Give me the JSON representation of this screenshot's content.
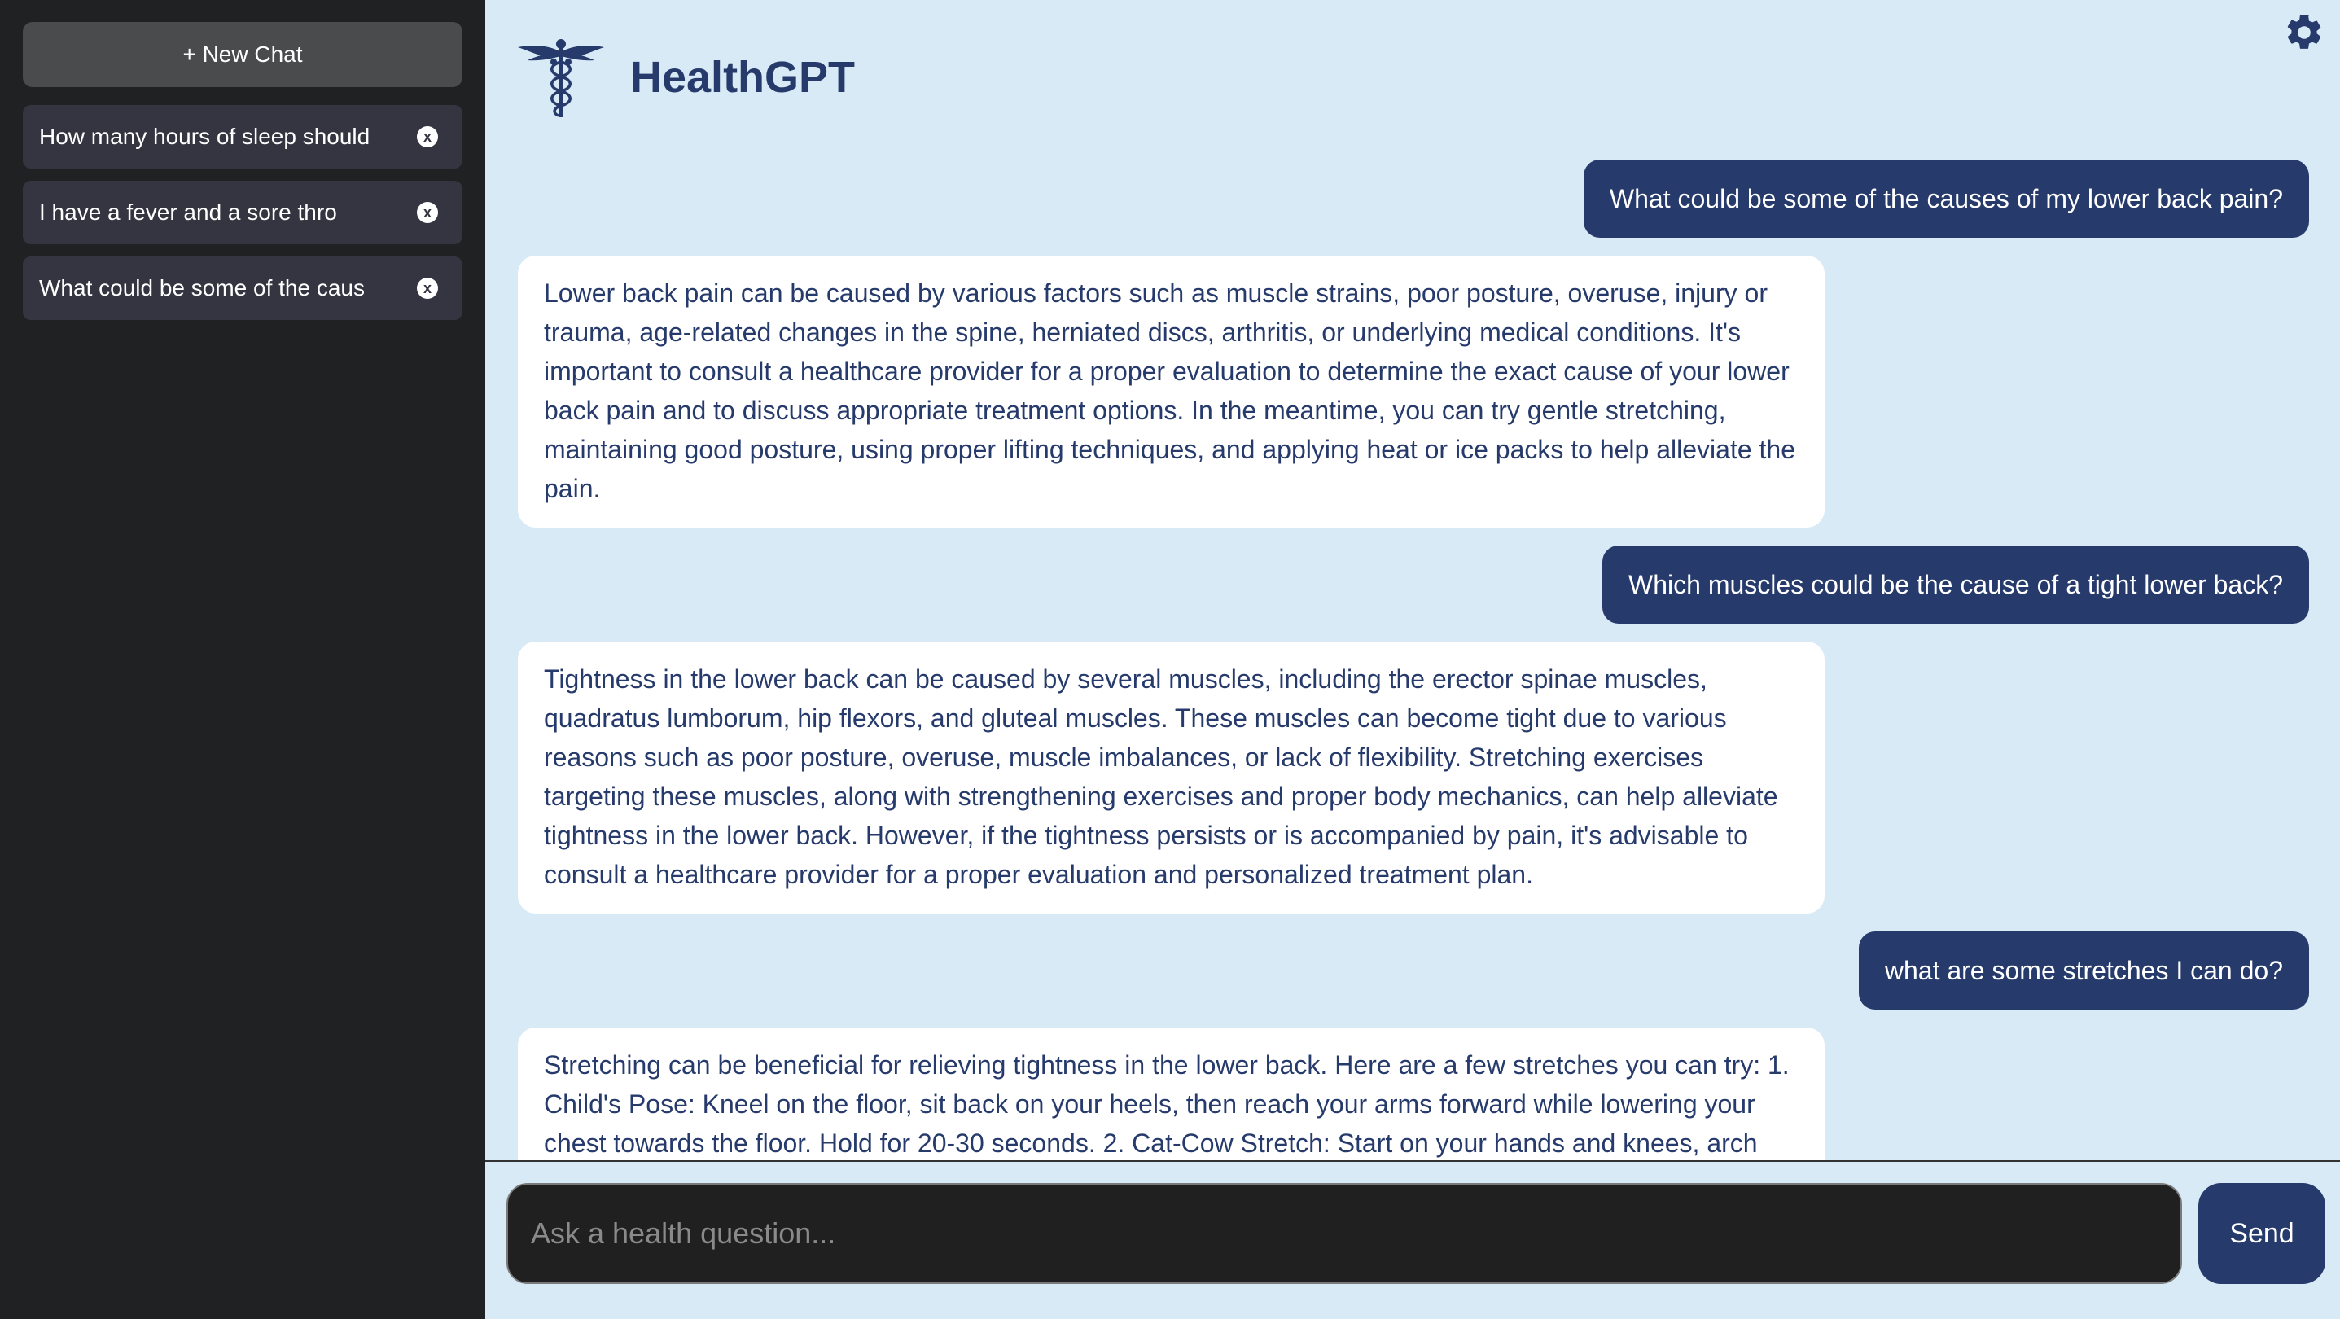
{
  "sidebar": {
    "new_chat_label": "+ New Chat",
    "history": [
      {
        "label": "How many hours of sleep should"
      },
      {
        "label": "I have a fever and a sore thro"
      },
      {
        "label": "What could be some of the caus"
      }
    ],
    "close_glyph": "x"
  },
  "header": {
    "title": "HealthGPT",
    "logo_icon": "caduceus-icon",
    "settings_icon": "gear-icon"
  },
  "messages": [
    {
      "role": "user",
      "text": "What could be some of the causes of my lower back pain?"
    },
    {
      "role": "assistant",
      "text": "Lower back pain can be caused by various factors such as muscle strains, poor posture, overuse, injury or trauma, age-related changes in the spine, herniated discs, arthritis, or underlying medical conditions. It's important to consult a healthcare provider for a proper evaluation to determine the exact cause of your lower back pain and to discuss appropriate treatment options. In the meantime, you can try gentle stretching, maintaining good posture, using proper lifting techniques, and applying heat or ice packs to help alleviate the pain."
    },
    {
      "role": "user",
      "text": "Which muscles could be the cause of a tight lower back?"
    },
    {
      "role": "assistant",
      "text": "Tightness in the lower back can be caused by several muscles, including the erector spinae muscles, quadratus lumborum, hip flexors, and gluteal muscles. These muscles can become tight due to various reasons such as poor posture, overuse, muscle imbalances, or lack of flexibility. Stretching exercises targeting these muscles, along with strengthening exercises and proper body mechanics, can help alleviate tightness in the lower back. However, if the tightness persists or is accompanied by pain, it's advisable to consult a healthcare provider for a proper evaluation and personalized treatment plan."
    },
    {
      "role": "user",
      "text": "what are some stretches I can do?"
    },
    {
      "role": "assistant",
      "text": "Stretching can be beneficial for relieving tightness in the lower back. Here are a few stretches you can try: 1. Child's Pose: Kneel on the floor, sit back on your heels, then reach your arms forward while lowering your chest towards the floor. Hold for 20-30 seconds. 2. Cat-Cow Stretch: Start on your hands and knees, arch"
    }
  ],
  "input": {
    "placeholder": "Ask a health question...",
    "value": ""
  },
  "send_label": "Send",
  "colors": {
    "sidebar_bg": "#202123",
    "main_bg": "#d8eaf6",
    "accent": "#263a6b",
    "user_text": "#ffffff",
    "input_bg": "#202020"
  }
}
